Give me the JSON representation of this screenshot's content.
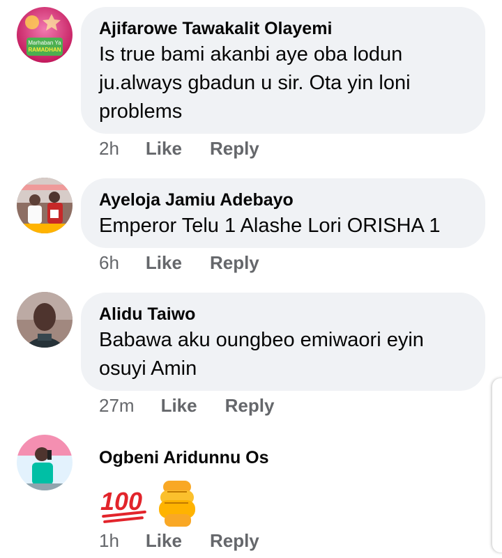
{
  "comments": [
    {
      "author": "Ajifarowe Tawakalit Olayemi",
      "text_lines": [
        "Is true bami akanbi aye oba lodun",
        "ju.always gbadun u sir. Ota yin loni",
        "problems"
      ],
      "time": "2h",
      "like_label": "Like",
      "reply_label": "Reply",
      "avatar_text": [
        "Marhaban Ya",
        "RAMADHAN"
      ]
    },
    {
      "author": "Ayeloja Jamiu Adebayo",
      "text_lines": [
        "Emperor Telu 1 Alashe Lori ORISHA 1"
      ],
      "time": "6h",
      "like_label": "Like",
      "reply_label": "Reply"
    },
    {
      "author": "Alidu Taiwo",
      "text_lines": [
        "Babawa aku oungbeo emiwaori eyin",
        "osuyi Amin"
      ],
      "time": "27m",
      "like_label": "Like",
      "reply_label": "Reply"
    },
    {
      "author": "Ogbeni Aridunnu Os",
      "emojis": [
        "hundred-points",
        "raised-fist"
      ],
      "time": "1h",
      "like_label": "Like",
      "reply_label": "Reply"
    }
  ],
  "colors": {
    "bubble_bg": "#f0f2f5",
    "author_text": "#050505",
    "meta_text": "#65676b"
  }
}
